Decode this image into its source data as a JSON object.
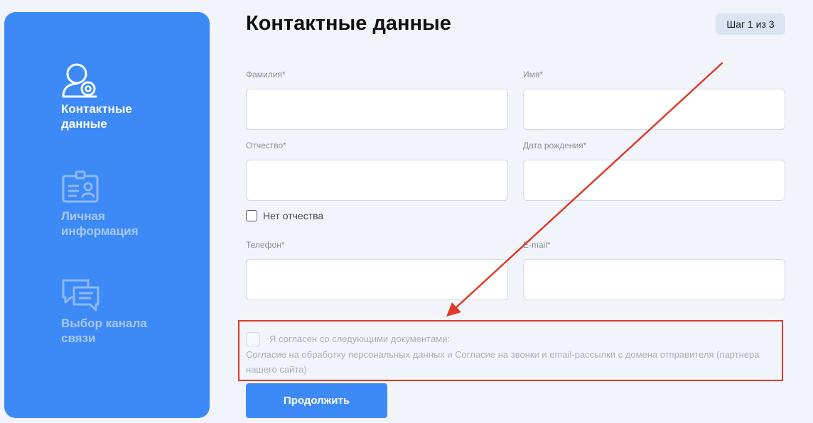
{
  "sidebar": {
    "steps": [
      {
        "label": "Контактные\nданные",
        "icon": "user-email-icon",
        "state": "active"
      },
      {
        "label": "Личная\nинформация",
        "icon": "id-card-icon",
        "state": "inactive"
      },
      {
        "label": "Выбор канала\nсвязи",
        "icon": "chat-bubbles-icon",
        "state": "inactive"
      }
    ]
  },
  "header": {
    "title": "Контактные данные",
    "step_badge": "Шаг 1 из 3"
  },
  "form": {
    "last_name": {
      "label": "Фамилия*",
      "value": ""
    },
    "first_name": {
      "label": "Имя*",
      "value": ""
    },
    "patronymic": {
      "label": "Отчество*",
      "value": ""
    },
    "birth_date": {
      "label": "Дата рождения*",
      "value": ""
    },
    "no_patronymic": {
      "label": "Нет отчества",
      "checked": false
    },
    "phone": {
      "label": "Телефон*",
      "value": ""
    },
    "email": {
      "label": "E-mail*",
      "value": ""
    }
  },
  "consent": {
    "title": "Я согласен со следующими документами:",
    "text": "Согласие на обработку персональных данных и Согласие на звонки и email-рассылки с домена отправителя (партнера нашего сайта)",
    "checked": false
  },
  "submit_label": "Продолжить",
  "colors": {
    "primary": "#3d8af7",
    "annotation": "#e03a2a",
    "background": "#f1f4fa"
  }
}
